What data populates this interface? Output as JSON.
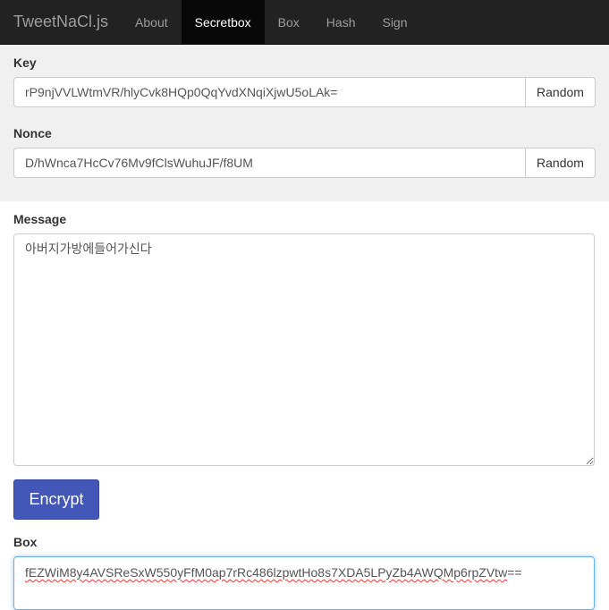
{
  "navbar": {
    "brand": "TweetNaCl.js",
    "items": [
      {
        "label": "About",
        "active": false
      },
      {
        "label": "Secretbox",
        "active": true
      },
      {
        "label": "Box",
        "active": false
      },
      {
        "label": "Hash",
        "active": false
      },
      {
        "label": "Sign",
        "active": false
      }
    ]
  },
  "key": {
    "label": "Key",
    "value": "rP9njVVLWtmVR/hlyCvk8HQp0QqYvdXNqiXjwU5oLAk=",
    "button": "Random"
  },
  "nonce": {
    "label": "Nonce",
    "value": "D/hWnca7HcCv76Mv9fClsWuhuJF/f8UM",
    "button": "Random"
  },
  "message": {
    "label": "Message",
    "value": "아버지가방에들어가신다"
  },
  "encrypt_button": "Encrypt",
  "box": {
    "label": "Box",
    "value_main": "fEZWiM8y4AVSReSxW550yFfM0ap7rRc486lzpwtHo8s7XDA5LPyZb4AWQMp6rpZVtw",
    "value_tail": "=="
  },
  "colors": {
    "navbar_bg": "#222222",
    "navbar_active_bg": "#080808",
    "gray_section_bg": "#f0f0f0",
    "encrypt_button_bg": "#4357b9",
    "focus_border": "#66afe9"
  }
}
